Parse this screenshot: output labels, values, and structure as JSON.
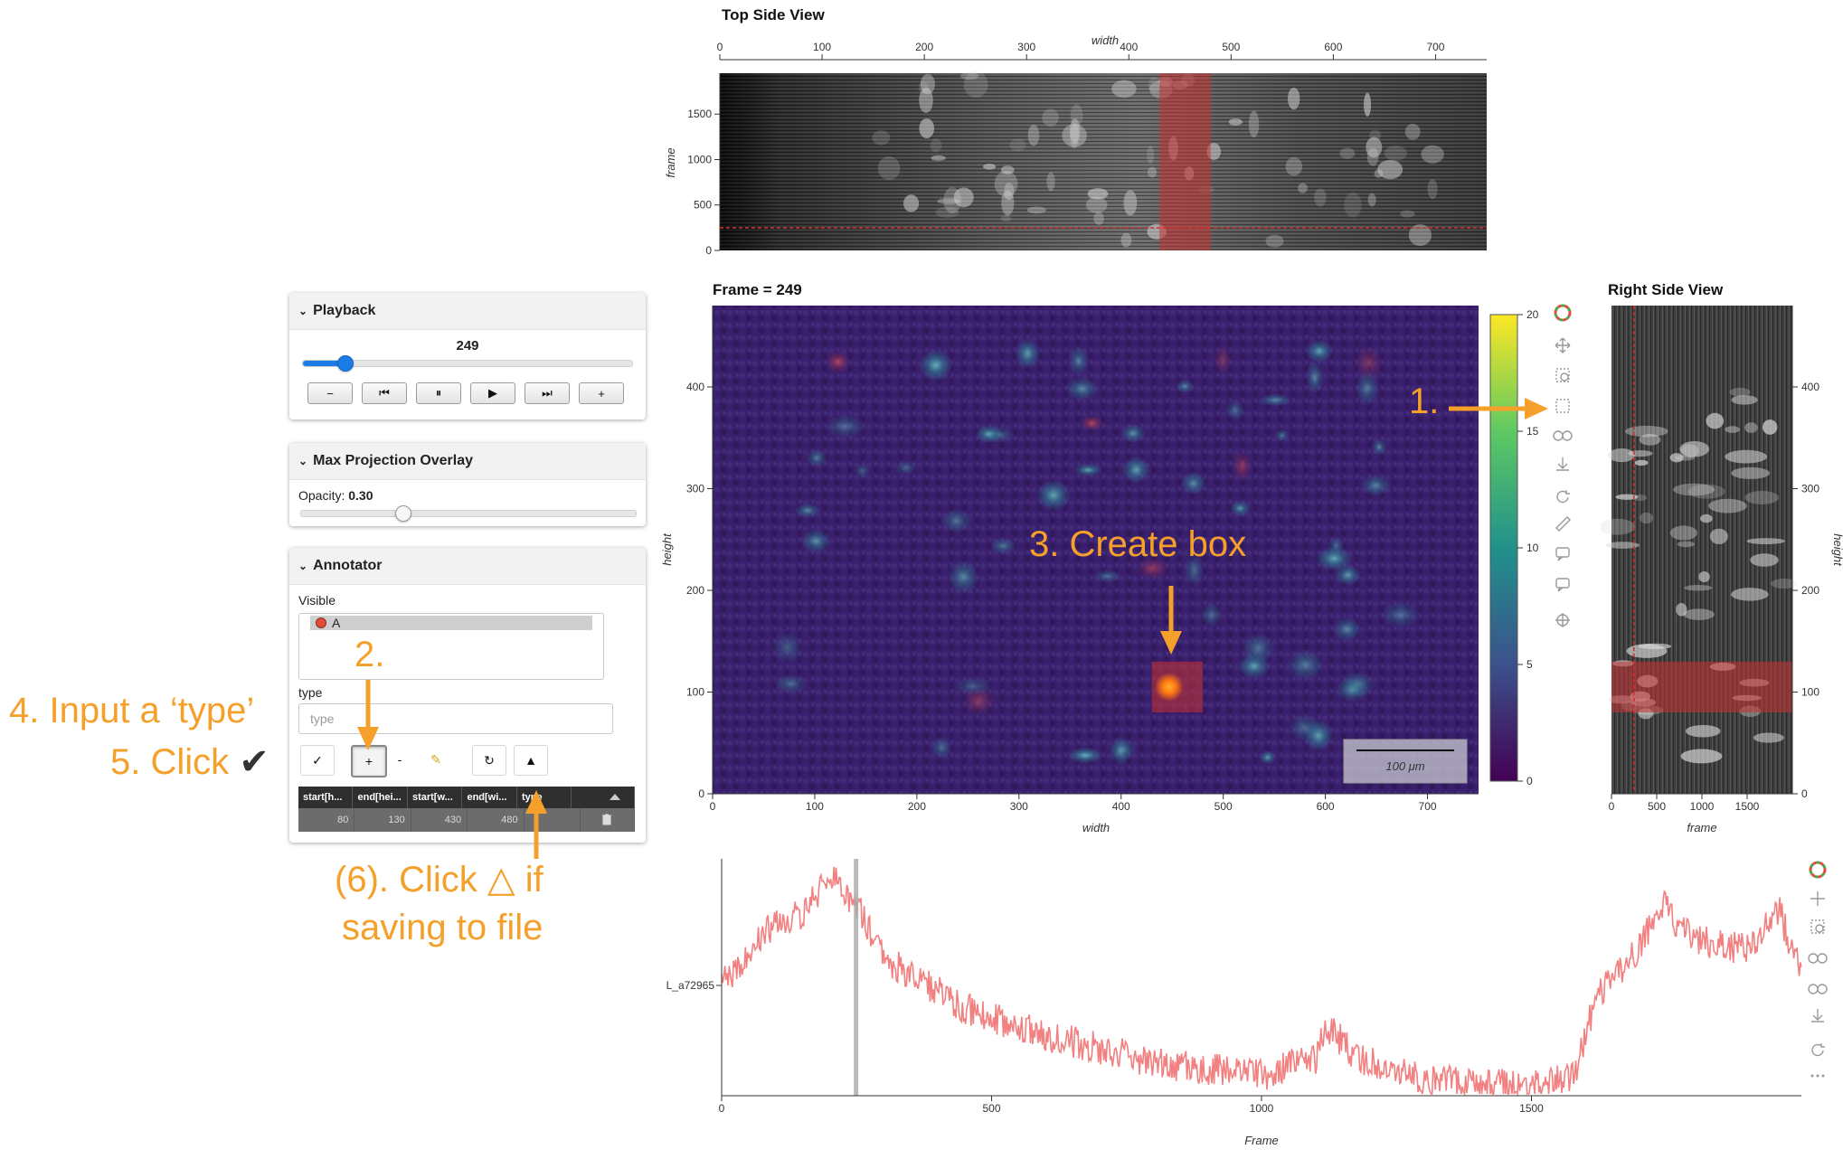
{
  "top_view": {
    "title": "Top Side View",
    "xlabel": "width",
    "ylabel": "frame",
    "x_ticks": [
      "0",
      "100",
      "200",
      "300",
      "400",
      "500",
      "600",
      "700"
    ],
    "y_ticks": [
      "0",
      "500",
      "1000",
      "1500"
    ],
    "highlight_x": [
      430,
      480
    ],
    "current_frame": 249
  },
  "main_view": {
    "title": "Frame = 249",
    "xlabel": "width",
    "ylabel": "height",
    "x_ticks": [
      "0",
      "100",
      "200",
      "300",
      "400",
      "500",
      "600",
      "700"
    ],
    "y_ticks": [
      "0",
      "100",
      "200",
      "300",
      "400"
    ],
    "colorbar_ticks": [
      "0",
      "5",
      "10",
      "15",
      "20"
    ],
    "colorbar_range": [
      0,
      20
    ],
    "scalebar_label": "100 μm",
    "annotation_box": {
      "x": [
        430,
        480
      ],
      "y": [
        80,
        130
      ]
    }
  },
  "right_view": {
    "title": "Right Side View",
    "xlabel": "frame",
    "ylabel": "height",
    "x_ticks": [
      "0",
      "500",
      "1000",
      "1500"
    ],
    "y_ticks": [
      "0",
      "100",
      "200",
      "300",
      "400"
    ],
    "highlight_y": [
      80,
      130
    ]
  },
  "trace": {
    "ylabel": "L_a72965",
    "xlabel": "Frame",
    "x_ticks": [
      "0",
      "500",
      "1000",
      "1500"
    ],
    "current_frame": 249,
    "line_color": "#f28080"
  },
  "playback": {
    "title": "Playback",
    "value": "249",
    "slider_fraction": 0.125,
    "buttons": [
      "−",
      "⏮",
      "⏸",
      "▶",
      "⏭",
      "+"
    ]
  },
  "overlay": {
    "title": "Max Projection Overlay",
    "opacity_label": "Opacity:",
    "opacity_value": "0.30"
  },
  "annotator": {
    "title": "Annotator",
    "visible_label": "Visible",
    "visible_item": "A",
    "type_label": "type",
    "type_placeholder": "type",
    "buttons": [
      "✓",
      "+",
      "-",
      "✎",
      "↻",
      "▲"
    ],
    "table_headers": [
      "start[h...",
      "end[hei...",
      "start[w...",
      "end[wi...",
      "type"
    ],
    "table_row": [
      "80",
      "130",
      "430",
      "480",
      ""
    ],
    "delete_icon": "trash-icon",
    "sort_icon": "caret-up-icon"
  },
  "annotations": {
    "step1": "1.",
    "step2": "2.",
    "step3": "3. Create box",
    "step4": "4. Input a ‘type’",
    "step5": "5. Click",
    "step5_mark": "✔",
    "step6_line1": "(6). Click △ if",
    "step6_line2": "saving to file",
    "accent_color": "#f5a02a"
  },
  "colors": {
    "highlight_red": "#c83232",
    "bokeh_tool_active": "#26aae1",
    "cursor_line": "#d43030"
  }
}
